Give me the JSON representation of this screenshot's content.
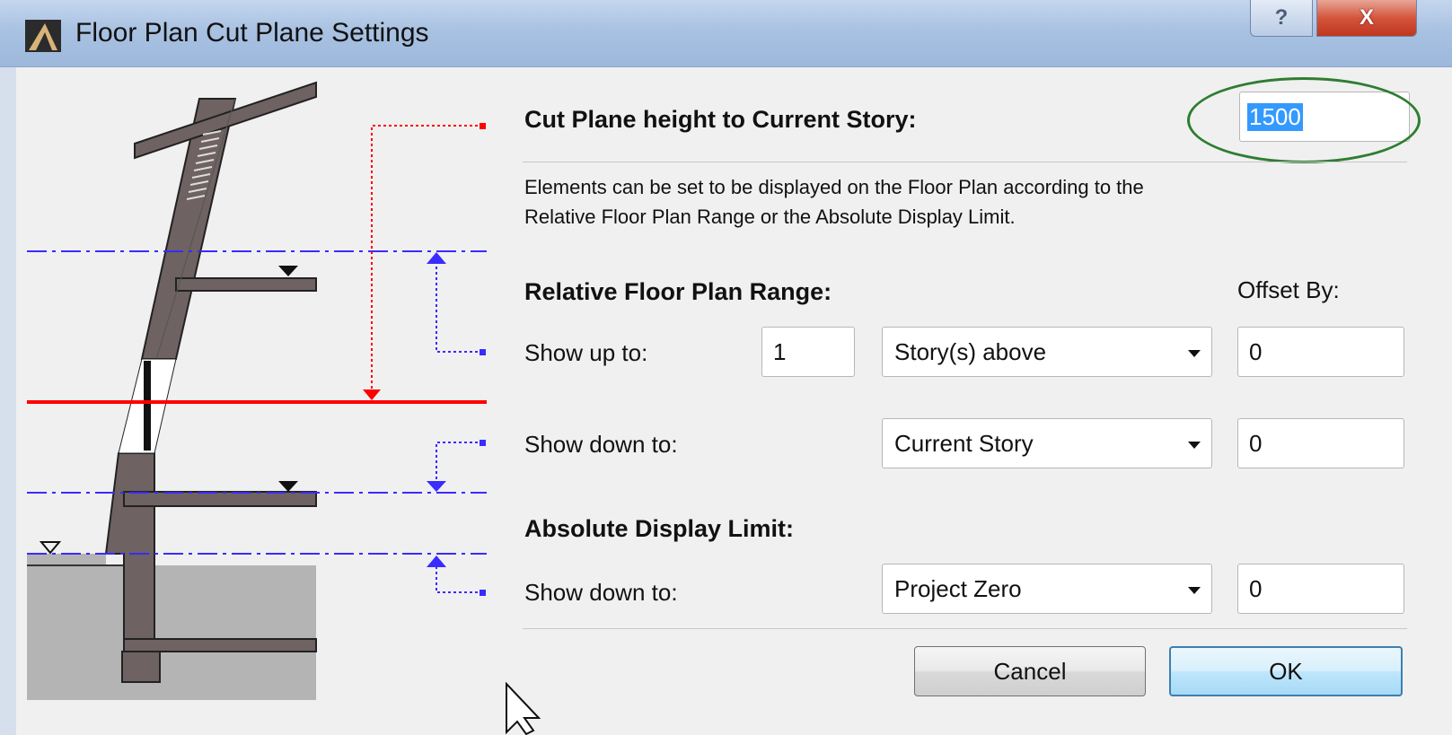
{
  "window": {
    "title": "Floor Plan Cut Plane Settings",
    "help_glyph": "?",
    "close_glyph": "X"
  },
  "cut_plane": {
    "label": "Cut Plane height to Current Story:",
    "value": "1500"
  },
  "description": {
    "line1": "Elements can be set to be displayed on the Floor Plan according to the",
    "line2": "Relative Floor Plan Range or the Absolute Display Limit."
  },
  "relative_range": {
    "heading": "Relative Floor Plan Range:",
    "offset_heading": "Offset By:",
    "show_up": {
      "label": "Show up to:",
      "count": "1",
      "select_value": "Story(s) above",
      "offset": "0"
    },
    "show_down": {
      "label": "Show down to:",
      "select_value": "Current Story",
      "offset": "0"
    }
  },
  "absolute_limit": {
    "heading": "Absolute Display Limit:",
    "show_down": {
      "label": "Show down to:",
      "select_value": "Project Zero",
      "offset": "0"
    }
  },
  "buttons": {
    "cancel": "Cancel",
    "ok": "OK"
  },
  "colors": {
    "cut_plane_line": "#ff0000",
    "range_lines": "#3a2bff",
    "wall": "#6e6262",
    "ground": "#b4b4b4",
    "annotation_oval": "#2e7d32"
  }
}
